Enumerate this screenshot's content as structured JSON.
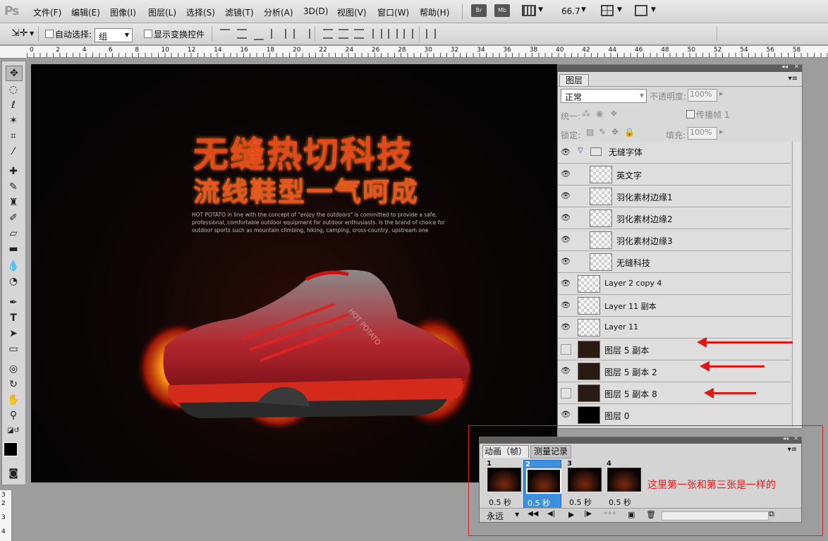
{
  "app": {
    "logo": "Ps"
  },
  "menu": [
    "文件(F)",
    "编辑(E)",
    "图像(I)",
    "图层(L)",
    "选择(S)",
    "滤镜(T)",
    "分析(A)",
    "3D(D)",
    "视图(V)",
    "窗口(W)",
    "帮助(H)"
  ],
  "menubar_buttons": {
    "br": "Br",
    "mb": "Mb",
    "zoom": "66.7"
  },
  "options": {
    "auto_select_label": "自动选择:",
    "auto_select_value": "组",
    "show_transform_label": "显示变换控件"
  },
  "ruler_top": [
    "0",
    "2",
    "4",
    "6",
    "8",
    "10",
    "12",
    "14",
    "16",
    "18",
    "20",
    "22",
    "24",
    "26",
    "28",
    "30",
    "32",
    "34",
    "36",
    "38",
    "40",
    "42",
    "44",
    "46",
    "48",
    "50",
    "52",
    "54",
    "56",
    "58"
  ],
  "ruler_left": [
    "3",
    "2",
    "3",
    "4"
  ],
  "canvas": {
    "headline1": "无缝热切科技",
    "headline2": "流线鞋型一气呵成",
    "blurb": "HOT POTATO in line with the concept of \"enjoy the outdoors\" is committed to provide a safe, professional, comfortable outdoor equipment for outdoor enthusiasts. Is the brand of choice for outdoor sports such as mountain climbing, hiking, camping, cross-country, upstream one",
    "shoe_brand": "HOT POTATO"
  },
  "layers_panel": {
    "tab": "图层",
    "blend_mode": "正常",
    "opacity_label": "不透明度:",
    "opacity_value": "100%",
    "unify_label": "统一:",
    "propagate_label": "传播帧 1",
    "lock_label": "锁定:",
    "fill_label": "填充:",
    "fill_value": "100%",
    "layers": [
      {
        "name": "无缝字体",
        "visible": true,
        "type": "group"
      },
      {
        "name": "英文字",
        "visible": true,
        "type": "child"
      },
      {
        "name": "羽化素材边缘1",
        "visible": true,
        "type": "child"
      },
      {
        "name": "羽化素材边缘2",
        "visible": true,
        "type": "child"
      },
      {
        "name": "羽化素材边缘3",
        "visible": true,
        "type": "child"
      },
      {
        "name": "无缝科技",
        "visible": true,
        "type": "child"
      },
      {
        "name": "Layer 2 copy 4",
        "visible": true,
        "type": "layer"
      },
      {
        "name": "Layer 11 副本",
        "visible": true,
        "type": "layer"
      },
      {
        "name": "Layer 11",
        "visible": true,
        "type": "layer"
      },
      {
        "name": "图层 5 副本",
        "visible": false,
        "type": "layer"
      },
      {
        "name": "图层 5 副本 2",
        "visible": true,
        "type": "layer"
      },
      {
        "name": "图层 5 副本 8",
        "visible": false,
        "type": "layer"
      },
      {
        "name": "图层 0",
        "visible": true,
        "type": "layer"
      }
    ]
  },
  "animation_panel": {
    "tabs": [
      "动画（帧）",
      "测量记录"
    ],
    "frames": [
      {
        "num": "1",
        "time": "0.5 秒"
      },
      {
        "num": "2",
        "time": "0.5 秒",
        "selected": true
      },
      {
        "num": "3",
        "time": "0.5 秒"
      },
      {
        "num": "4",
        "time": "0.5 秒"
      }
    ],
    "loop": "永远"
  },
  "annotation": "这里第一张和第三张是一样的",
  "colors": {
    "accent_red": "#e21515",
    "selection_blue": "#3d8fe0"
  }
}
